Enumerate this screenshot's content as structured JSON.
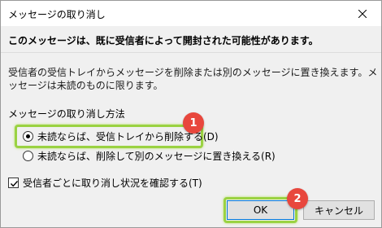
{
  "window": {
    "title": "メッセージの取り消し",
    "close_icon": "close-icon"
  },
  "headline": "このメッセージは、既に受信者によって開封された可能性があります。",
  "description": "受信者の受信トレイからメッセージを削除または別のメッセージに置き換えます。メッセージは未読のものに限ります。",
  "method": {
    "label": "メッセージの取り消し方法",
    "options": [
      {
        "label": "未読ならば、受信トレイから削除する(D)",
        "checked": true
      },
      {
        "label": "未読ならば、削除して別のメッセージに置き換える(R)",
        "checked": false
      }
    ]
  },
  "confirm_checkbox": {
    "label": "受信者ごとに取り消し状況を確認する(T)",
    "checked": true
  },
  "buttons": {
    "ok": "OK",
    "cancel": "キャンセル"
  },
  "annotations": {
    "badge1": "1",
    "badge2": "2",
    "highlight_color": "#9ad242",
    "badge_color": "#e8473d"
  }
}
